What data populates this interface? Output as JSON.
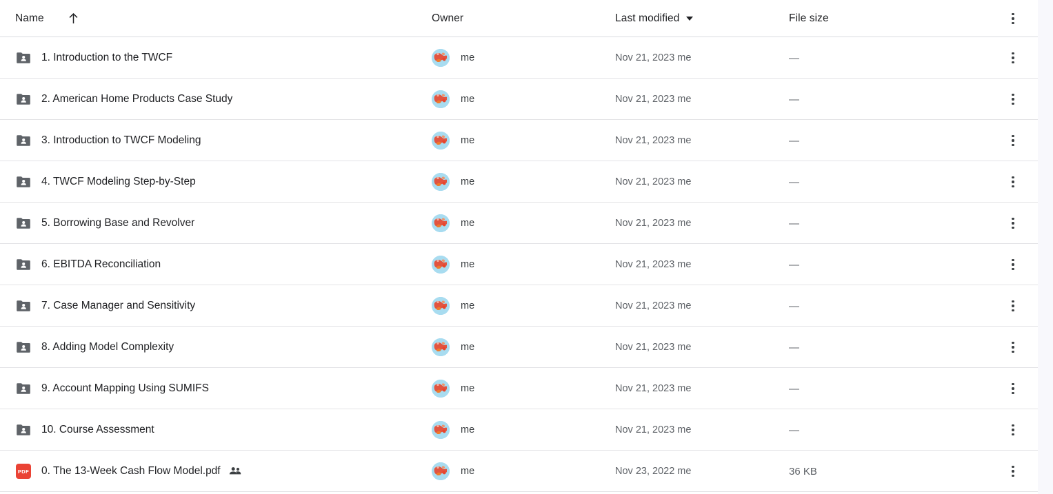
{
  "columns": {
    "name": "Name",
    "owner": "Owner",
    "last_modified": "Last modified",
    "file_size": "File size",
    "sort_icon": "arrow-up-icon",
    "sort_direction_icon": "chevron-down-icon",
    "overflow_icon": "kebab-menu-icon"
  },
  "colors": {
    "folder_icon": "#5f6368",
    "pdf_icon": "#ea4335",
    "divider": "#e3e3e6",
    "header_divider": "#dadce0",
    "text_primary": "#202124",
    "text_secondary": "#5f6368",
    "avatar_background": "#9fd4ee",
    "avatar_art": "#e8452c"
  },
  "rows": [
    {
      "icon": "shared-folder-icon",
      "type": "folder",
      "name": "1. Introduction to the TWCF",
      "shared": false,
      "owner": "me",
      "last_modified": "Nov 21, 2023 me",
      "file_size": "—"
    },
    {
      "icon": "shared-folder-icon",
      "type": "folder",
      "name": "2. American Home Products Case Study",
      "shared": false,
      "owner": "me",
      "last_modified": "Nov 21, 2023 me",
      "file_size": "—"
    },
    {
      "icon": "shared-folder-icon",
      "type": "folder",
      "name": "3. Introduction to TWCF Modeling",
      "shared": false,
      "owner": "me",
      "last_modified": "Nov 21, 2023 me",
      "file_size": "—"
    },
    {
      "icon": "shared-folder-icon",
      "type": "folder",
      "name": "4. TWCF Modeling Step-by-Step",
      "shared": false,
      "owner": "me",
      "last_modified": "Nov 21, 2023 me",
      "file_size": "—"
    },
    {
      "icon": "shared-folder-icon",
      "type": "folder",
      "name": "5. Borrowing Base and Revolver",
      "shared": false,
      "owner": "me",
      "last_modified": "Nov 21, 2023 me",
      "file_size": "—"
    },
    {
      "icon": "shared-folder-icon",
      "type": "folder",
      "name": "6. EBITDA Reconciliation",
      "shared": false,
      "owner": "me",
      "last_modified": "Nov 21, 2023 me",
      "file_size": "—"
    },
    {
      "icon": "shared-folder-icon",
      "type": "folder",
      "name": "7. Case Manager and Sensitivity",
      "shared": false,
      "owner": "me",
      "last_modified": "Nov 21, 2023 me",
      "file_size": "—"
    },
    {
      "icon": "shared-folder-icon",
      "type": "folder",
      "name": "8. Adding Model Complexity",
      "shared": false,
      "owner": "me",
      "last_modified": "Nov 21, 2023 me",
      "file_size": "—"
    },
    {
      "icon": "shared-folder-icon",
      "type": "folder",
      "name": "9. Account Mapping Using SUMIFS",
      "shared": false,
      "owner": "me",
      "last_modified": "Nov 21, 2023 me",
      "file_size": "—"
    },
    {
      "icon": "shared-folder-icon",
      "type": "folder",
      "name": "10. Course Assessment",
      "shared": false,
      "owner": "me",
      "last_modified": "Nov 21, 2023 me",
      "file_size": "—"
    },
    {
      "icon": "pdf-file-icon",
      "type": "pdf",
      "name": "0. The 13-Week Cash Flow Model.pdf",
      "shared": true,
      "owner": "me",
      "last_modified": "Nov 23, 2022 me",
      "file_size": "36 KB"
    }
  ],
  "pdf_badge_label": "PDF"
}
